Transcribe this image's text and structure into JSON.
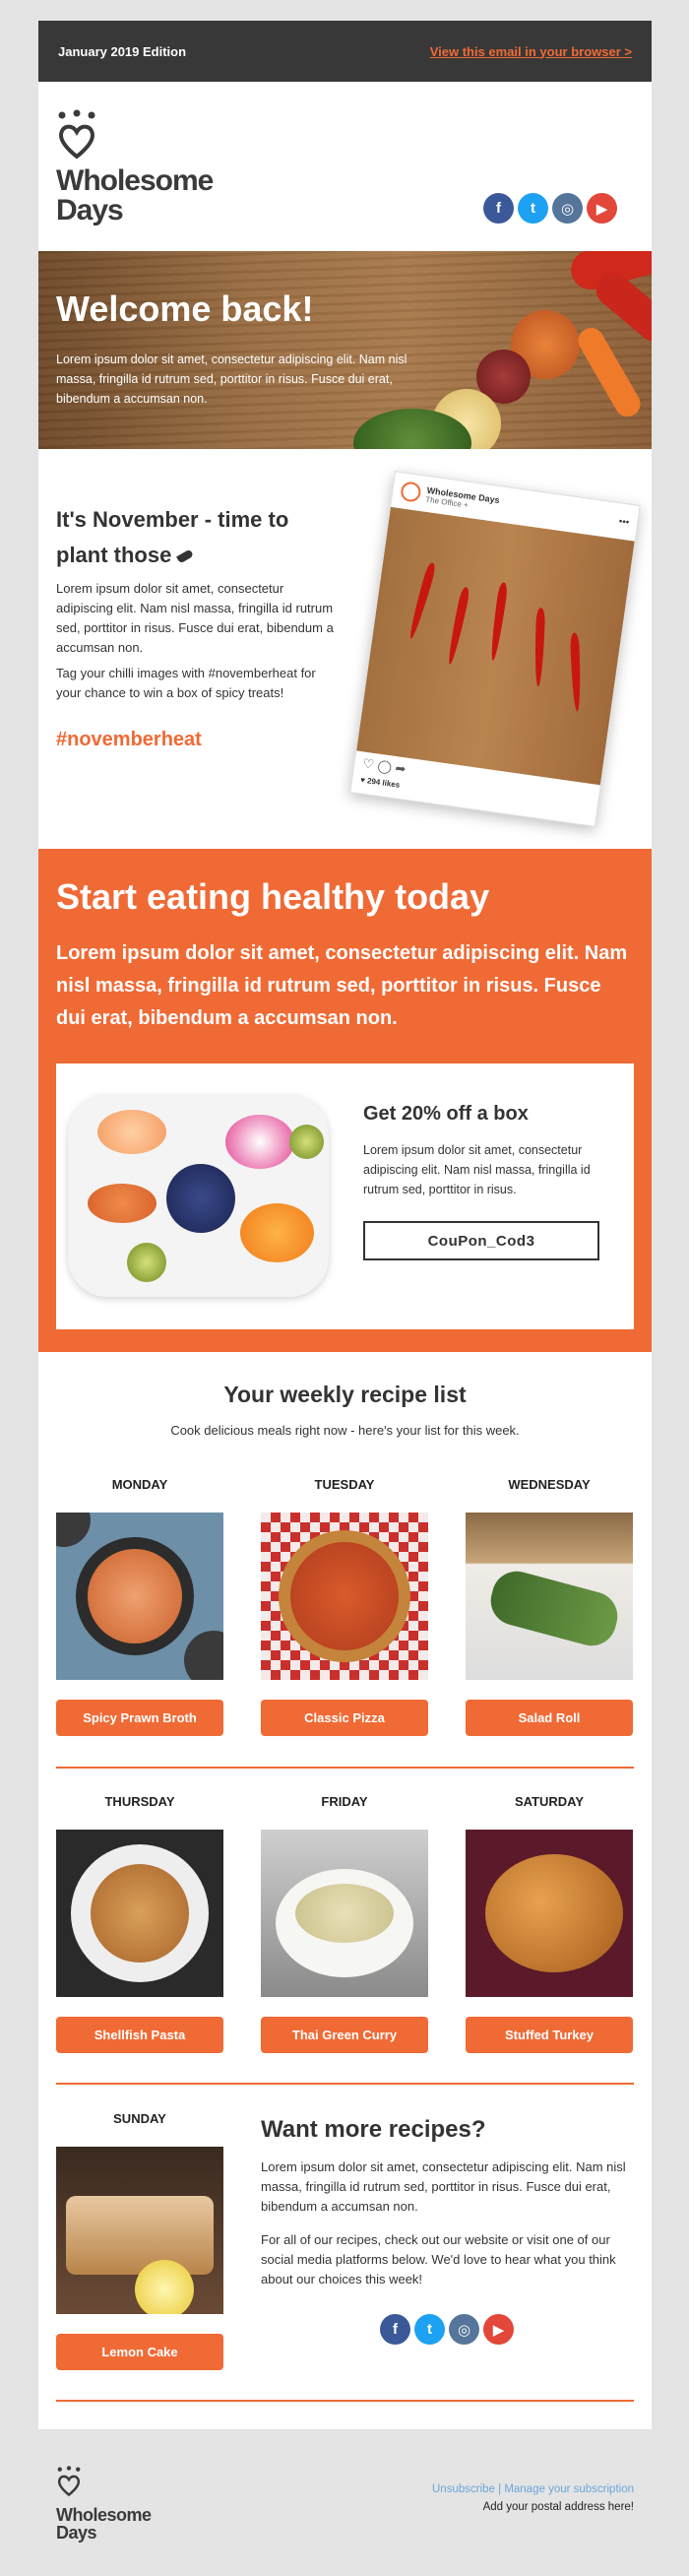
{
  "header": {
    "edition": "January 2019 Edition",
    "view_link": "View this email in your browser >"
  },
  "brand": {
    "name_line1": "Wholesome",
    "name_line2": "Days"
  },
  "social_icons": [
    "facebook-icon",
    "twitter-icon",
    "instagram-icon",
    "youtube-icon"
  ],
  "hero": {
    "title": "Welcome back!",
    "body": "Lorem ipsum dolor sit amet, consectetur adipiscing elit. Nam nisl massa, fringilla id rutrum sed, porttitor in risus. Fusce dui erat, bibendum a accumsan non."
  },
  "november": {
    "title": "It's November - time to plant those",
    "body1": "Lorem ipsum dolor sit amet, consectetur adipiscing elit. Nam nisl massa, fringilla id rutrum sed, porttitor in risus. Fusce dui erat, bibendum a accumsan non.",
    "body2": "Tag your chilli images with #novemberheat for your chance to win a box of spicy treats!",
    "hashtag": "#novemberheat",
    "post": {
      "account": "Wholesome Days",
      "location": "The Office +",
      "likes": "♥ 294 likes"
    }
  },
  "promo": {
    "title": "Start eating healthy today",
    "lead": "Lorem ipsum dolor sit amet, consectetur adipiscing elit. Nam nisl massa, fringilla id rutrum sed, porttitor in risus. Fusce dui erat, bibendum a accumsan non.",
    "offer_title": "Get 20% off a box",
    "offer_body": "Lorem ipsum dolor sit amet, consectetur adipiscing elit. Nam nisl massa, fringilla id rutrum sed, porttitor in risus.",
    "coupon": "CouPon_Cod3"
  },
  "recipes": {
    "title": "Your weekly recipe list",
    "subtitle": "Cook delicious meals right now - here's your list for this week.",
    "days": [
      {
        "day": "MONDAY",
        "dish": "Spicy Prawn Broth"
      },
      {
        "day": "TUESDAY",
        "dish": "Classic Pizza"
      },
      {
        "day": "WEDNESDAY",
        "dish": "Salad Roll"
      },
      {
        "day": "THURSDAY",
        "dish": "Shellfish Pasta"
      },
      {
        "day": "FRIDAY",
        "dish": "Thai Green Curry"
      },
      {
        "day": "SATURDAY",
        "dish": "Stuffed Turkey"
      },
      {
        "day": "SUNDAY",
        "dish": "Lemon Cake"
      }
    ]
  },
  "more": {
    "title": "Want more recipes?",
    "body1": "Lorem ipsum dolor sit amet, consectetur adipiscing elit. Nam nisl massa, fringilla id rutrum sed, porttitor in risus. Fusce dui erat, bibendum a accumsan non.",
    "body2": "For all of our recipes, check out our website or visit one of our social media platforms below. We'd love to hear what you think about our choices this week!"
  },
  "footer": {
    "unsubscribe": "Unsubscribe",
    "separator": " | ",
    "manage": "Manage your subscription",
    "address": "Add your postal address here!"
  },
  "colors": {
    "accent": "#f06a35",
    "dark": "#383838",
    "link_blue": "#6aa5d8"
  }
}
